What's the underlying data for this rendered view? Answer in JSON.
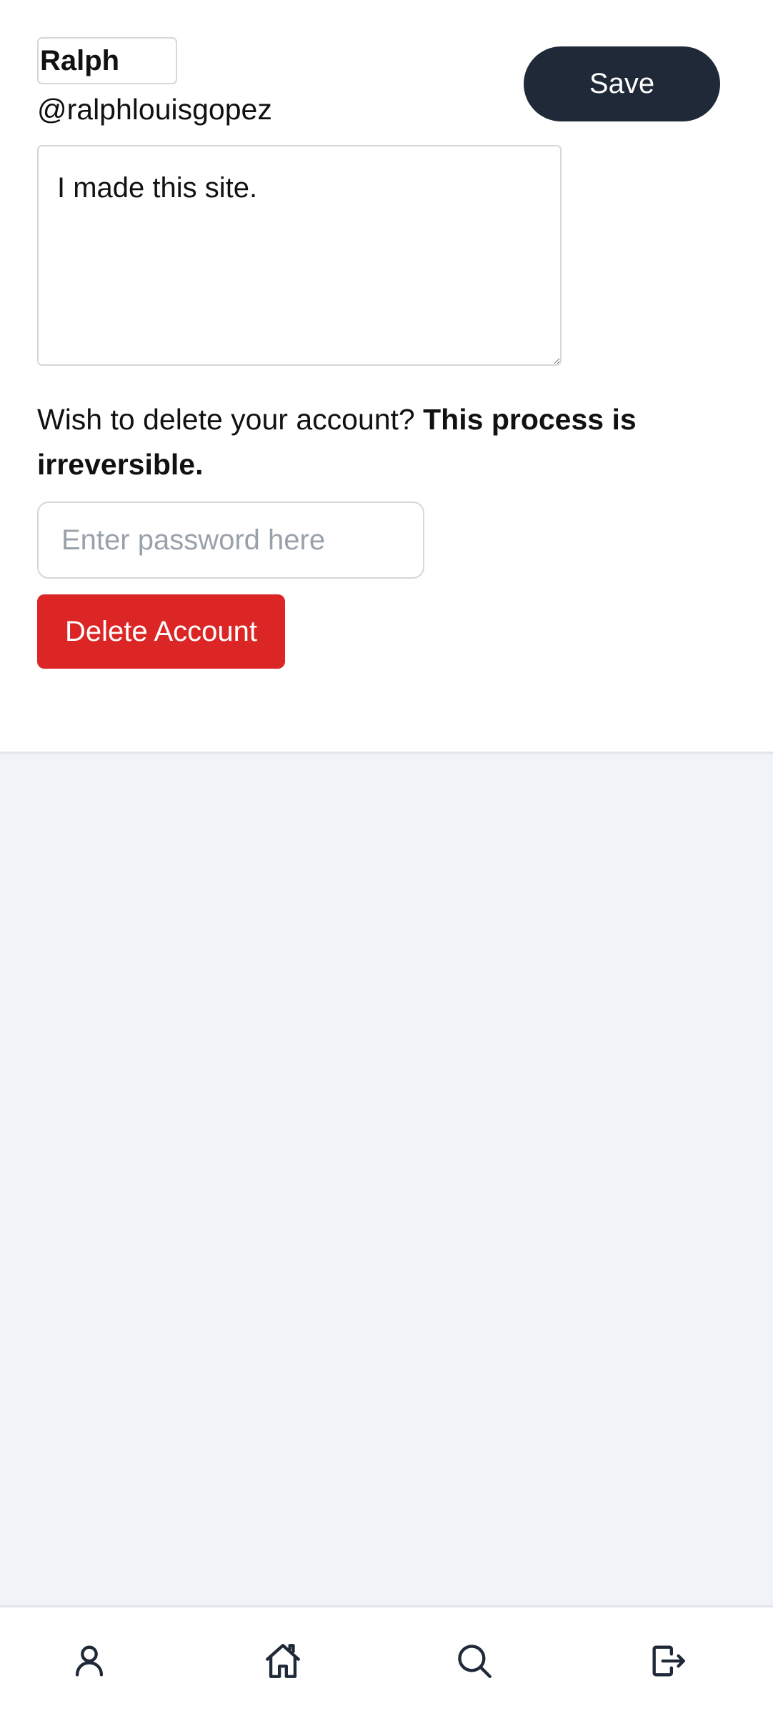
{
  "profile": {
    "name_value": "Ralph",
    "handle": "@ralphlouisgopez",
    "bio_value": "I made this site."
  },
  "actions": {
    "save_label": "Save"
  },
  "delete_section": {
    "warning_text": "Wish to delete your account? ",
    "warning_bold": "This process is irreversible.",
    "password_placeholder": "Enter password here",
    "delete_label": "Delete Account"
  },
  "bottom_nav": {
    "items": [
      {
        "icon": "user-icon"
      },
      {
        "icon": "home-icon"
      },
      {
        "icon": "search-icon"
      },
      {
        "icon": "logout-icon"
      }
    ]
  },
  "colors": {
    "primary_button": "#1f2937",
    "danger_button": "#dc2626",
    "page_background": "#f0f3f7"
  }
}
